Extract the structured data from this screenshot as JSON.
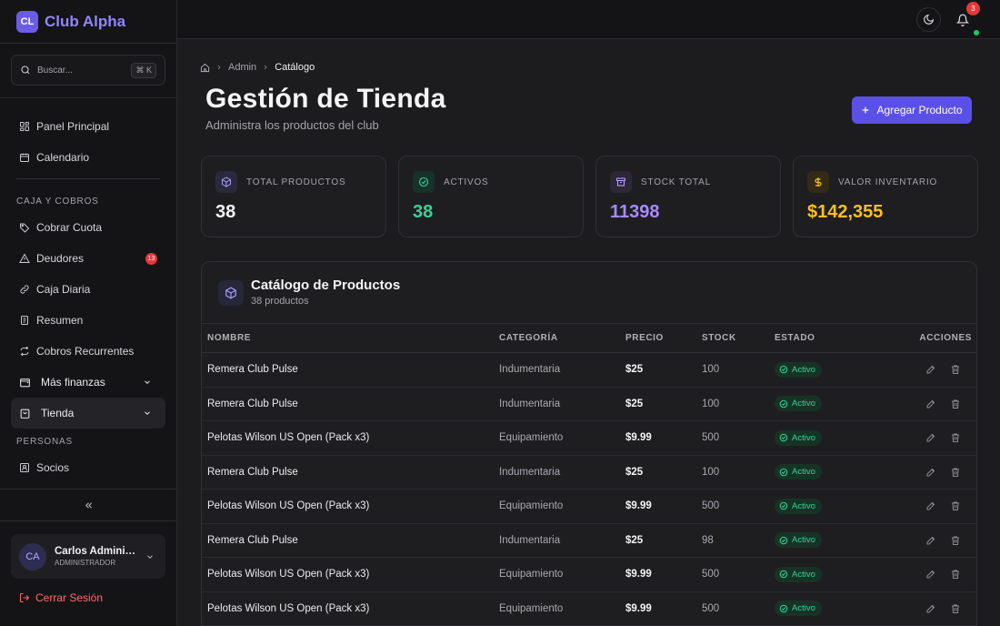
{
  "brand": {
    "logo": "CL",
    "name": "Club Alpha"
  },
  "search": {
    "placeholder": "Buscar...",
    "shortcut": "⌘ K"
  },
  "sidebar": {
    "top_items": [
      {
        "label": "Panel Principal",
        "icon": "grid-icon"
      },
      {
        "label": "Calendario",
        "icon": "calendar-icon"
      }
    ],
    "section_caja": "CAJA Y COBROS",
    "caja_items": [
      {
        "label": "Cobrar Cuota",
        "icon": "tag-icon"
      },
      {
        "label": "Deudores",
        "icon": "warning-icon",
        "badge": "13"
      },
      {
        "label": "Caja Diaria",
        "icon": "link-icon"
      },
      {
        "label": "Resumen",
        "icon": "receipt-icon"
      },
      {
        "label": "Cobros Recurrentes",
        "icon": "repeat-icon"
      }
    ],
    "groups": [
      {
        "label": "Más finanzas",
        "icon": "wallet-icon"
      },
      {
        "label": "Tienda",
        "icon": "bag-icon"
      }
    ],
    "section_personas": "PERSONAS",
    "personas_items": [
      {
        "label": "Socios",
        "icon": "id-card-icon"
      }
    ]
  },
  "user": {
    "initials": "CA",
    "name": "Carlos Administrador",
    "role": "ADMINISTRADOR"
  },
  "logout_label": "Cerrar Sesión",
  "topbar": {
    "notifications": "3"
  },
  "breadcrumb": {
    "home_icon": "home-icon",
    "parent": "Admin",
    "current": "Catálogo"
  },
  "page": {
    "title": "Gestión de Tienda",
    "subtitle": "Administra los productos del club",
    "add_button": "Agregar Producto"
  },
  "stats": [
    {
      "label": "TOTAL PRODUCTOS",
      "value": "38",
      "color": "#f5f5f7",
      "icon": "box-icon"
    },
    {
      "label": "ACTIVOS",
      "value": "38",
      "color": "#34d399",
      "icon": "check-circle-icon"
    },
    {
      "label": "STOCK TOTAL",
      "value": "11398",
      "color": "#a78bfa",
      "icon": "archive-icon"
    },
    {
      "label": "VALOR INVENTARIO",
      "value": "$142,355",
      "color": "#fbbf24",
      "icon": "dollar-icon"
    }
  ],
  "catalog": {
    "title": "Catálogo de Productos",
    "subtitle": "38 productos",
    "columns": [
      "NOMBRE",
      "CATEGORÍA",
      "PRECIO",
      "STOCK",
      "ESTADO",
      "ACCIONES"
    ],
    "rows": [
      {
        "name": "Remera Club Pulse",
        "category": "Indumentaria",
        "price": "$25",
        "stock": "100",
        "status": "Activo"
      },
      {
        "name": "Remera Club Pulse",
        "category": "Indumentaria",
        "price": "$25",
        "stock": "100",
        "status": "Activo"
      },
      {
        "name": "Pelotas Wilson US Open (Pack x3)",
        "category": "Equipamiento",
        "price": "$9.99",
        "stock": "500",
        "status": "Activo"
      },
      {
        "name": "Remera Club Pulse",
        "category": "Indumentaria",
        "price": "$25",
        "stock": "100",
        "status": "Activo"
      },
      {
        "name": "Pelotas Wilson US Open (Pack x3)",
        "category": "Equipamiento",
        "price": "$9.99",
        "stock": "500",
        "status": "Activo"
      },
      {
        "name": "Remera Club Pulse",
        "category": "Indumentaria",
        "price": "$25",
        "stock": "98",
        "status": "Activo"
      },
      {
        "name": "Pelotas Wilson US Open (Pack x3)",
        "category": "Equipamiento",
        "price": "$9.99",
        "stock": "500",
        "status": "Activo"
      },
      {
        "name": "Pelotas Wilson US Open (Pack x3)",
        "category": "Equipamiento",
        "price": "$9.99",
        "stock": "500",
        "status": "Activo"
      }
    ]
  }
}
